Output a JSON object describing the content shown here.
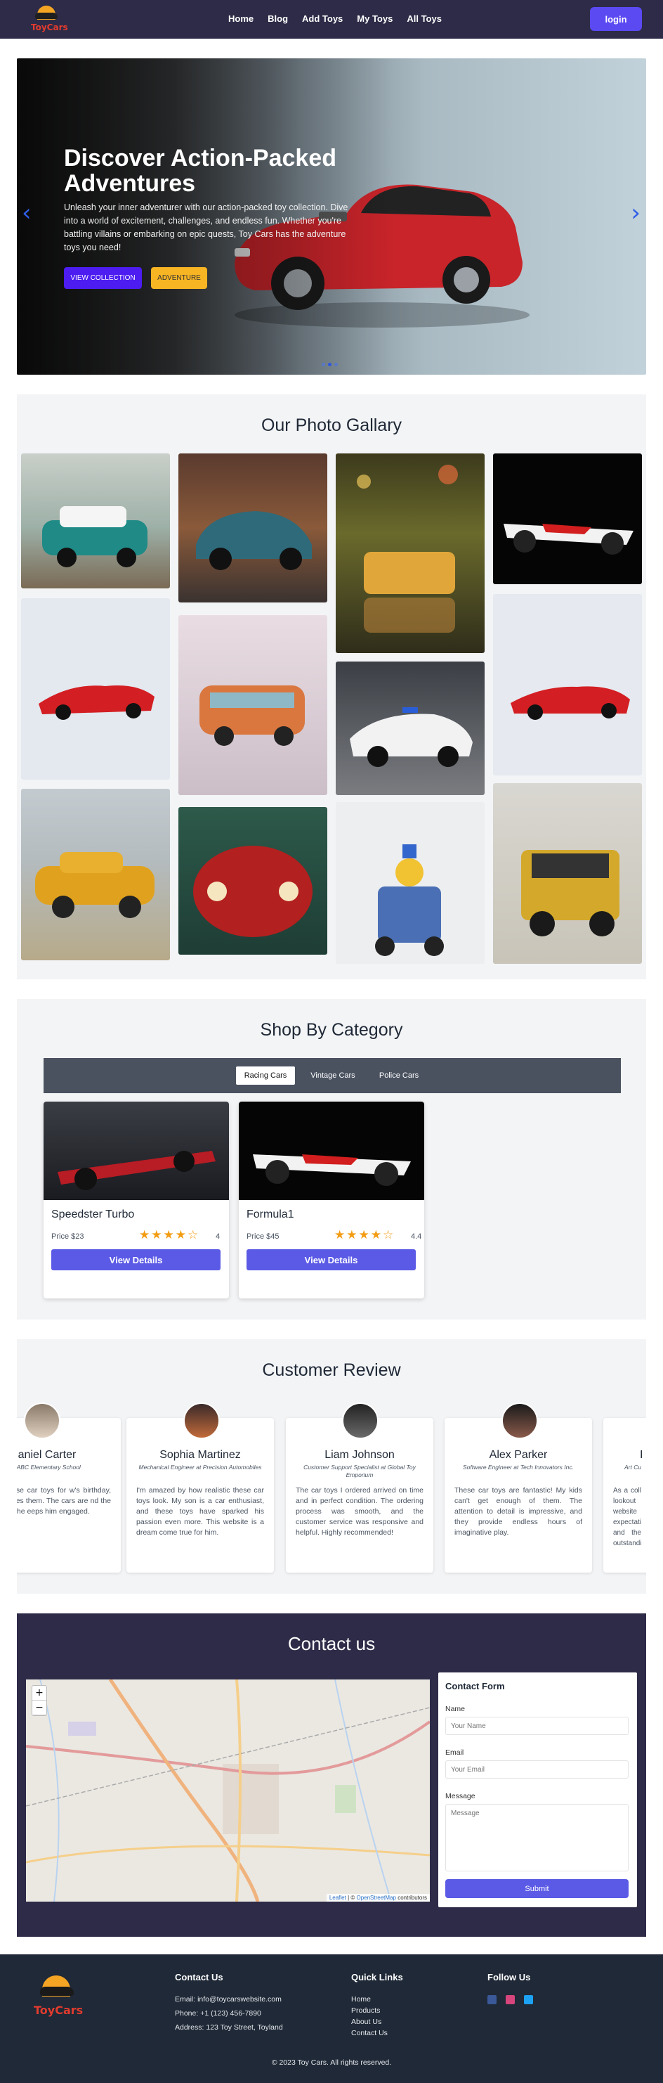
{
  "nav": {
    "brand": "ToyCars",
    "links": [
      "Home",
      "Blog",
      "Add Toys",
      "My Toys",
      "All Toys"
    ],
    "login_label": "login"
  },
  "hero": {
    "title": "Discover Action-Packed Adventures",
    "description": "Unleash your inner adventurer with our action-packed toy collection. Dive into a world of excitement, challenges, and endless fun. Whether you're battling villains or embarking on epic quests, Toy Cars has the adventure toys you need!",
    "btn_collection": "VIEW COLLECTION",
    "btn_adventure": "ADVENTURE",
    "prev_icon": "‹",
    "next_icon": "›",
    "slides": 3,
    "active_slide": 2
  },
  "gallery": {
    "title": "Our Photo Gallary"
  },
  "category": {
    "title": "Shop By Category",
    "tabs": [
      "Racing Cars",
      "Vintage Cars",
      "Police Cars"
    ],
    "active_tab": "Racing Cars",
    "products": [
      {
        "name": "Speedster Turbo",
        "price": "Price $23",
        "rating": "4",
        "stars": 4,
        "button": "View Details"
      },
      {
        "name": "Formula1",
        "price": "Price $45",
        "rating": "4.4",
        "stars": 4,
        "button": "View Details"
      }
    ]
  },
  "reviews": {
    "title": "Customer Review",
    "items": [
      {
        "name": "aniel Carter",
        "role": "t ABC Elementary School",
        "text": "set of these car toys for w's birthday, and he oves them. The cars are nd the variety in the eeps him engaged."
      },
      {
        "name": "Sophia Martinez",
        "role": "Mechanical Engineer at Precision Automobiles",
        "text": "I'm amazed by how realistic these car toys look. My son is a car enthusiast, and these toys have sparked his passion even more. This website is a dream come true for him."
      },
      {
        "name": "Liam Johnson",
        "role": "Customer Support Specialist at Global Toy Emporium",
        "text": "The car toys I ordered arrived on time and in perfect condition. The ordering process was smooth, and the customer service was responsive and helpful. Highly recommended!"
      },
      {
        "name": "Alex Parker",
        "role": "Software Engineer at Tech Innovators Inc.",
        "text": "These car toys are fantastic! My kids can't get enough of them. The attention to detail is impressive, and they provide endless hours of imaginative play."
      },
      {
        "name": "I",
        "role": "Art Cu",
        "text": "As a coll lookout website expectati and the outstandi"
      }
    ]
  },
  "contact": {
    "title": "Contact us",
    "map_attrib_link": "Leaflet",
    "map_attrib_mid": " | © ",
    "map_attrib_osm": "OpenStreetMap",
    "map_attrib_end": " contributors",
    "zoom_in": "+",
    "zoom_out": "−",
    "form": {
      "title": "Contact Form",
      "name_label": "Name",
      "name_placeholder": "Your Name",
      "email_label": "Email",
      "email_placeholder": "Your Email",
      "message_label": "Message",
      "message_placeholder": "Message",
      "submit": "Submit"
    }
  },
  "footer": {
    "brand": "ToyCars",
    "contact_title": "Contact Us",
    "email": "Email: info@toycarswebsite.com",
    "phone": "Phone: +1 (123) 456-7890",
    "address": "Address: 123 Toy Street, Toyland",
    "links_title": "Quick Links",
    "links": [
      "Home",
      "Products",
      "About Us",
      "Contact Us"
    ],
    "follow_title": "Follow Us",
    "copyright": "© 2023 Toy Cars. All rights reserved."
  },
  "colors": {
    "nav_bg": "#2d2b47",
    "accent": "#5b49f2",
    "button": "#5b5ae6",
    "star": "#f39c12",
    "adventure": "#f7b423"
  }
}
